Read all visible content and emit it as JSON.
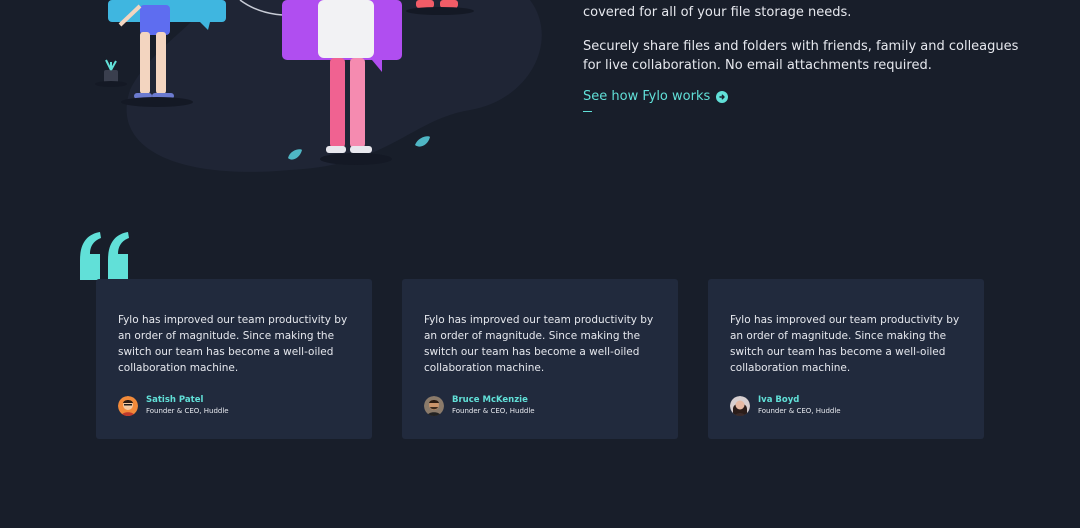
{
  "productive": {
    "paragraph_1_tail": "covered for all of your file storage needs.",
    "paragraph_2": "Securely share files and folders with friends, family and colleagues for live collaboration. No email attachments required.",
    "cta_label": "See how Fylo works"
  },
  "testimonials": [
    {
      "quote": "Fylo has improved our team productivity by an order of magnitude. Since making the switch our team has become a well-oiled collaboration machine.",
      "name": "Satish Patel",
      "role": "Founder & CEO, Huddle"
    },
    {
      "quote": "Fylo has improved our team productivity by an order of magnitude. Since making the switch our team has become a well-oiled collaboration machine.",
      "name": "Bruce McKenzie",
      "role": "Founder & CEO, Huddle"
    },
    {
      "quote": "Fylo has improved our team productivity by an order of magnitude. Since making the switch our team has become a well-oiled collaboration machine.",
      "name": "Iva Boyd",
      "role": "Founder & CEO, Huddle"
    }
  ],
  "colors": {
    "background": "#181e2a",
    "card": "#212a3d",
    "accent": "#61e0d8",
    "text": "#e6e8ee"
  },
  "icons": {
    "quote": "quote-icon",
    "arrow": "arrow-circle-icon"
  }
}
